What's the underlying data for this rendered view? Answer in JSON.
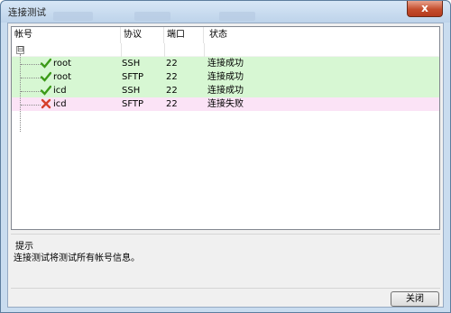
{
  "window": {
    "title": "连接测试",
    "close_label": "x"
  },
  "table": {
    "columns": [
      {
        "key": "account",
        "label": "帐号"
      },
      {
        "key": "protocol",
        "label": "协议"
      },
      {
        "key": "port",
        "label": "端口"
      },
      {
        "key": "status",
        "label": "状态"
      }
    ],
    "tree_toggle": "⊟",
    "rows": [
      {
        "account": "root",
        "protocol": "SSH",
        "port": "22",
        "status": "连接成功",
        "result": "success"
      },
      {
        "account": "root",
        "protocol": "SFTP",
        "port": "22",
        "status": "连接成功",
        "result": "success"
      },
      {
        "account": "icd",
        "protocol": "SSH",
        "port": "22",
        "status": "连接成功",
        "result": "success"
      },
      {
        "account": "icd",
        "protocol": "SFTP",
        "port": "22",
        "status": "连接失败",
        "result": "failure"
      }
    ],
    "colors": {
      "success_row": "#d7f7d3",
      "failure_row": "#fbe3f6",
      "check": "#3c9a18",
      "cross": "#d6402c"
    }
  },
  "hint": {
    "title": "提示",
    "text": "连接测试将测试所有帐号信息。"
  },
  "buttons": {
    "close_label": "关闭"
  }
}
